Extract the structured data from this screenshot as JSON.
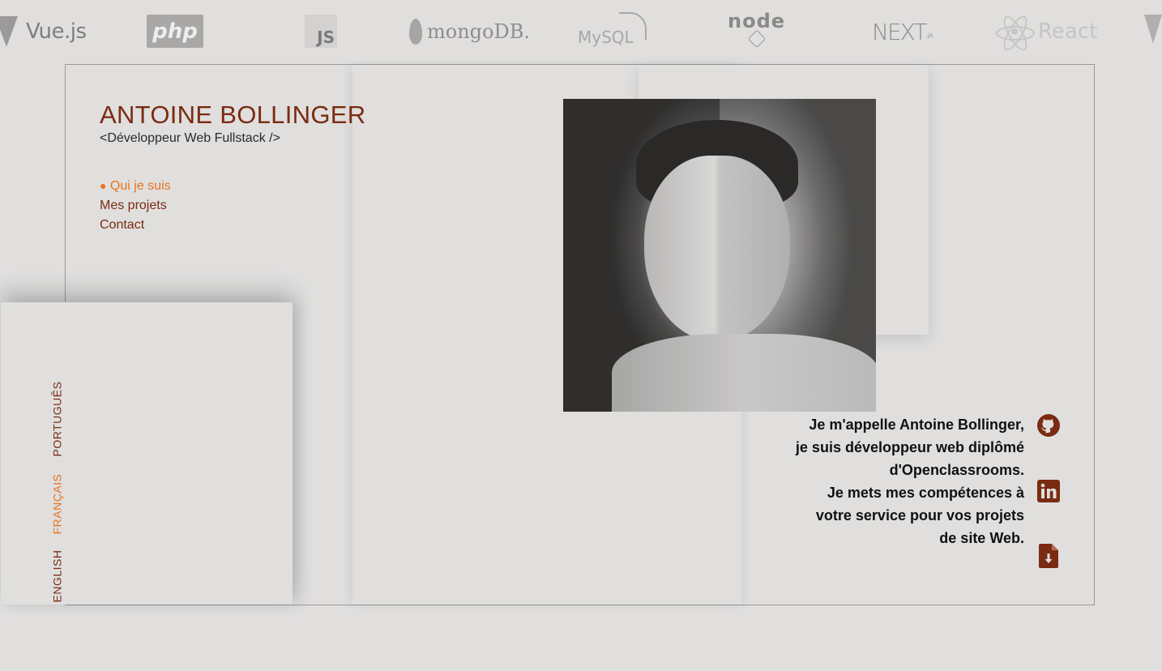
{
  "logos": [
    "Vue.js",
    "php",
    "JS",
    "mongoDB.",
    "MySQL",
    "node",
    "NEXT",
    ".js",
    "React"
  ],
  "header": {
    "name": "ANTOINE BOLLINGER",
    "subtitle": "<Développeur Web Fullstack />"
  },
  "nav": {
    "bullet": "●",
    "items": [
      {
        "label": "Qui je suis",
        "active": true
      },
      {
        "label": "Mes projets",
        "active": false
      },
      {
        "label": "Contact",
        "active": false
      }
    ]
  },
  "bio": {
    "line1": "Je m'appelle Antoine Bollinger, je suis développeur web diplômé d'Openclassrooms.",
    "line2": "Je mets mes compétences à votre service pour vos projets de site Web."
  },
  "social": {
    "icons": [
      "github-icon",
      "linkedin-icon",
      "file-download-icon"
    ]
  },
  "languages": [
    {
      "label": "ENGLISH",
      "active": false
    },
    {
      "label": "FRANÇAIS",
      "active": true
    },
    {
      "label": "PORTUGUÊS",
      "active": false
    }
  ],
  "colors": {
    "background": "#e0dfde",
    "brand": "#7a2b11",
    "accent": "#e8721f",
    "text": "#111111",
    "logo_gray": "#8a8988"
  }
}
